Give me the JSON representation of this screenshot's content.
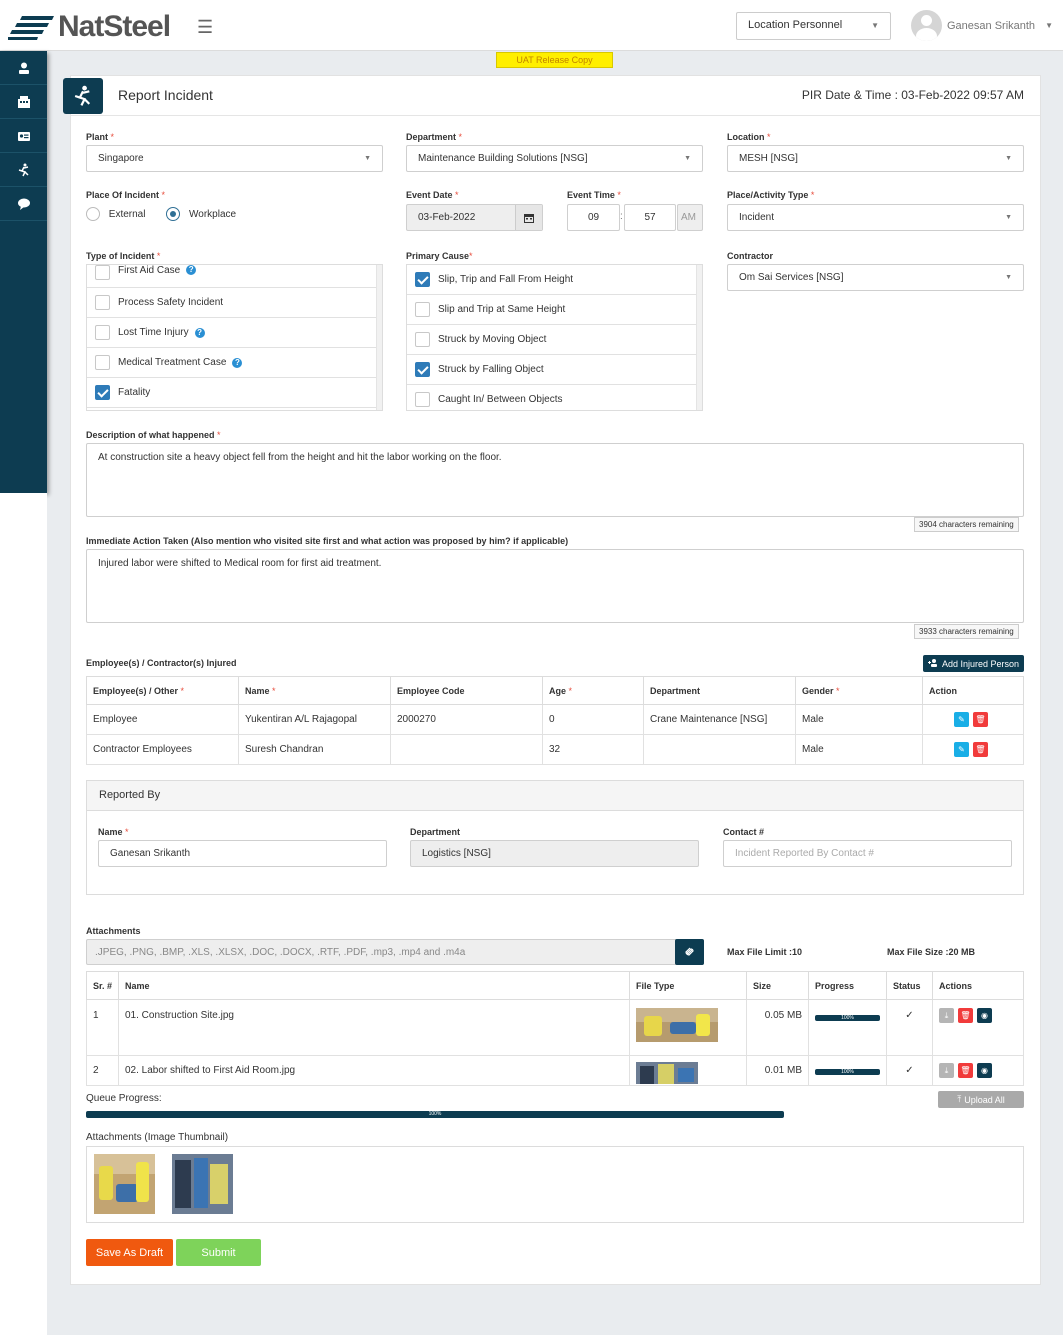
{
  "header": {
    "brand": "NatSteel",
    "role_select": "Location Personnel",
    "user_name": "Ganesan Srikanth"
  },
  "sidebar": {
    "items": [
      {
        "icon": "person-badge-icon"
      },
      {
        "icon": "building-icon"
      },
      {
        "icon": "id-card-icon"
      },
      {
        "icon": "incident-person-icon"
      },
      {
        "icon": "chat-bubble-icon"
      }
    ]
  },
  "banner": "UAT Release Copy",
  "page": {
    "title": "Report Incident",
    "pir_date": "PIR Date & Time : 03-Feb-2022 09:57 AM"
  },
  "form": {
    "plant": {
      "label": "Plant",
      "value": "Singapore"
    },
    "department": {
      "label": "Department",
      "value": "Maintenance Building Solutions [NSG]"
    },
    "location": {
      "label": "Location",
      "value": "MESH [NSG]"
    },
    "place_of_incident": {
      "label": "Place Of Incident",
      "options": [
        "External",
        "Workplace"
      ],
      "selected": "Workplace"
    },
    "event_date": {
      "label": "Event Date",
      "value": "03-Feb-2022"
    },
    "event_time": {
      "label": "Event Time",
      "hour": "09",
      "minute": "57",
      "ampm": "AM"
    },
    "place_activity": {
      "label": "Place/Activity Type",
      "value": "Incident"
    },
    "type_of_incident": {
      "label": "Type of Incident",
      "items": [
        {
          "label": "First Aid Case",
          "checked": false,
          "help": true
        },
        {
          "label": "Process Safety Incident",
          "checked": false,
          "help": false
        },
        {
          "label": "Lost Time Injury",
          "checked": false,
          "help": true
        },
        {
          "label": "Medical Treatment Case",
          "checked": false,
          "help": true
        },
        {
          "label": "Fatality",
          "checked": true,
          "help": false
        }
      ]
    },
    "primary_cause": {
      "label": "Primary Cause",
      "items": [
        {
          "label": "Slip, Trip and Fall From Height",
          "checked": true
        },
        {
          "label": "Slip and Trip at Same Height",
          "checked": false
        },
        {
          "label": "Struck by Moving Object",
          "checked": false
        },
        {
          "label": "Struck by Falling Object",
          "checked": true
        },
        {
          "label": "Caught In/ Between Objects",
          "checked": false
        }
      ]
    },
    "contractor": {
      "label": "Contractor",
      "value": "Om Sai Services [NSG]"
    },
    "description": {
      "label": "Description of what happened",
      "value": "At construction site a heavy object fell from the height and hit the labor working on the floor.",
      "remaining": "3904 characters remaining"
    },
    "immediate_action": {
      "label": "Immediate Action Taken (Also mention who visited site first and what action was proposed by him? if applicable)",
      "value": "Injured labor were shifted to Medical room for first aid treatment.",
      "remaining": "3933 characters remaining"
    }
  },
  "injured": {
    "label": "Employee(s) / Contractor(s) Injured",
    "add_button": "Add Injured Person",
    "columns": [
      "Employee(s) / Other",
      "Name",
      "Employee Code",
      "Age",
      "Department",
      "Gender",
      "Action"
    ],
    "required": [
      true,
      true,
      false,
      true,
      false,
      true,
      false
    ],
    "rows": [
      [
        "Employee",
        "Yukentiran A/L Rajagopal",
        "2000270",
        "0",
        "Crane Maintenance [NSG]",
        "Male"
      ],
      [
        "Contractor Employees",
        "Suresh Chandran",
        "",
        "32",
        "",
        "Male"
      ]
    ]
  },
  "reported_by": {
    "title": "Reported By",
    "name_label": "Name",
    "name": "Ganesan Srikanth",
    "dept_label": "Department",
    "dept": "Logistics [NSG]",
    "contact_label": "Contact #",
    "contact_placeholder": "Incident Reported By Contact #"
  },
  "attachments": {
    "label": "Attachments",
    "file_types": ".JPEG, .PNG, .BMP, .XLS, .XLSX, .DOC, .DOCX, .RTF, .PDF, .mp3, .mp4 and .m4a",
    "max_file_limit": "Max File Limit :10",
    "max_file_size": "Max File Size :20 MB",
    "columns": [
      "Sr. #",
      "Name",
      "File Type",
      "Size",
      "Progress",
      "Status",
      "Actions"
    ],
    "rows": [
      {
        "sr": "1",
        "name": "01. Construction Site.jpg",
        "size": "0.05 MB",
        "progress": "100%",
        "progress_value": 1.0,
        "status": "✓"
      },
      {
        "sr": "2",
        "name": "02. Labor shifted to First Aid Room.jpg",
        "size": "0.01 MB",
        "progress": "100%",
        "progress_value": 1.0,
        "status": "✓"
      }
    ],
    "queue_label": "Queue Progress:",
    "queue_progress": "100%",
    "queue_progress_value": 1.0,
    "upload_all": "Upload All",
    "thumbnails_label": "Attachments (Image Thumbnail)"
  },
  "actions": {
    "save_draft": "Save As Draft",
    "submit": "Submit"
  },
  "colors": {
    "primary": "#0d3c51",
    "save": "#f0590f",
    "submit": "#7ed35a",
    "banner": "#ffef00"
  }
}
